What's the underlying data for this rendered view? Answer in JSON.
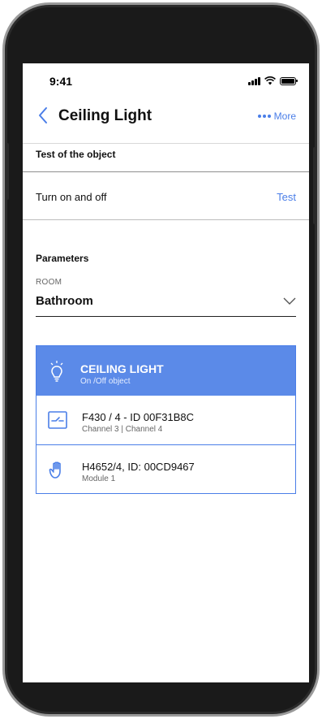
{
  "status_bar": {
    "time": "9:41"
  },
  "header": {
    "title": "Ceiling Light",
    "more_label": "More"
  },
  "test_section": {
    "heading": "Test of the object",
    "row_label": "Turn on and off",
    "row_action": "Test"
  },
  "parameters": {
    "heading": "Parameters",
    "room_label": "ROOM",
    "room_value": "Bathroom"
  },
  "object_card": {
    "title": "CEILING LIGHT",
    "subtitle": "On /Off object",
    "items": [
      {
        "title": "F430 / 4 - ID 00F31B8C",
        "subtitle": "Channel 3 | Channel 4",
        "icon": "switch-icon"
      },
      {
        "title": "H4652/4, ID: 00CD9467",
        "subtitle": "Module 1",
        "icon": "hand-icon"
      }
    ]
  },
  "colors": {
    "accent": "#4a7ee8",
    "card_header": "#5b8ae8",
    "text": "#111111"
  }
}
